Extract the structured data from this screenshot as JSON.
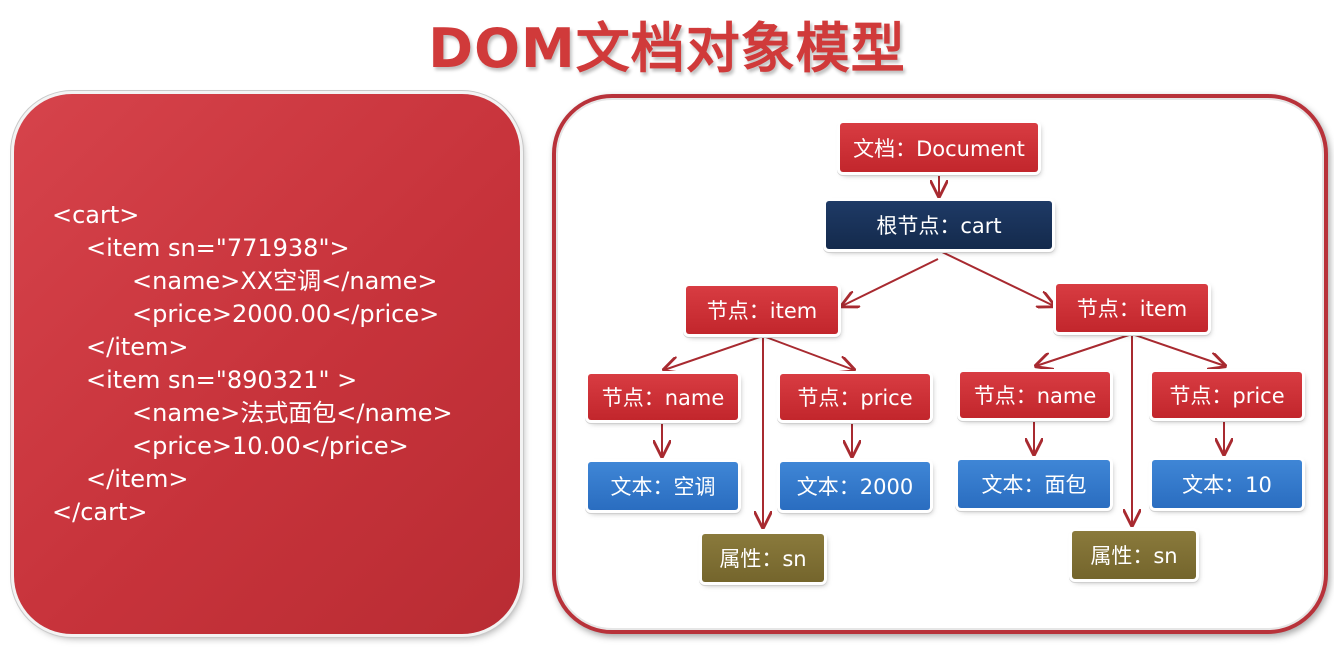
{
  "title": "DOM文档对象模型",
  "code": {
    "lines": [
      "<cart>",
      "<item sn=\"771938\">",
      "<name>XX空调</name>",
      "<price>2000.00</price>",
      "</item>",
      "<item sn=\"890321\" >",
      "<name>法式面包</name>",
      "<price>10.00</price>",
      "</item>",
      "</cart>"
    ]
  },
  "tree": {
    "document": "文档：Document",
    "root": "根节点：cart",
    "item1": "节点：item",
    "item2": "节点：item",
    "name1": "节点：name",
    "price1": "节点：price",
    "name2": "节点：name",
    "price2": "节点：price",
    "text1": "文本：空调",
    "text2": "文本：2000",
    "text3": "文本：面包",
    "text4": "文本：10",
    "attr1": "属性：sn",
    "attr2": "属性：sn"
  },
  "colors": {
    "accent_red": "#c8323a",
    "node_red": "#c9292f",
    "node_navy": "#172f55",
    "node_blue": "#2f76c8",
    "node_olive": "#7e6f33",
    "arrow": "#a82a30"
  }
}
